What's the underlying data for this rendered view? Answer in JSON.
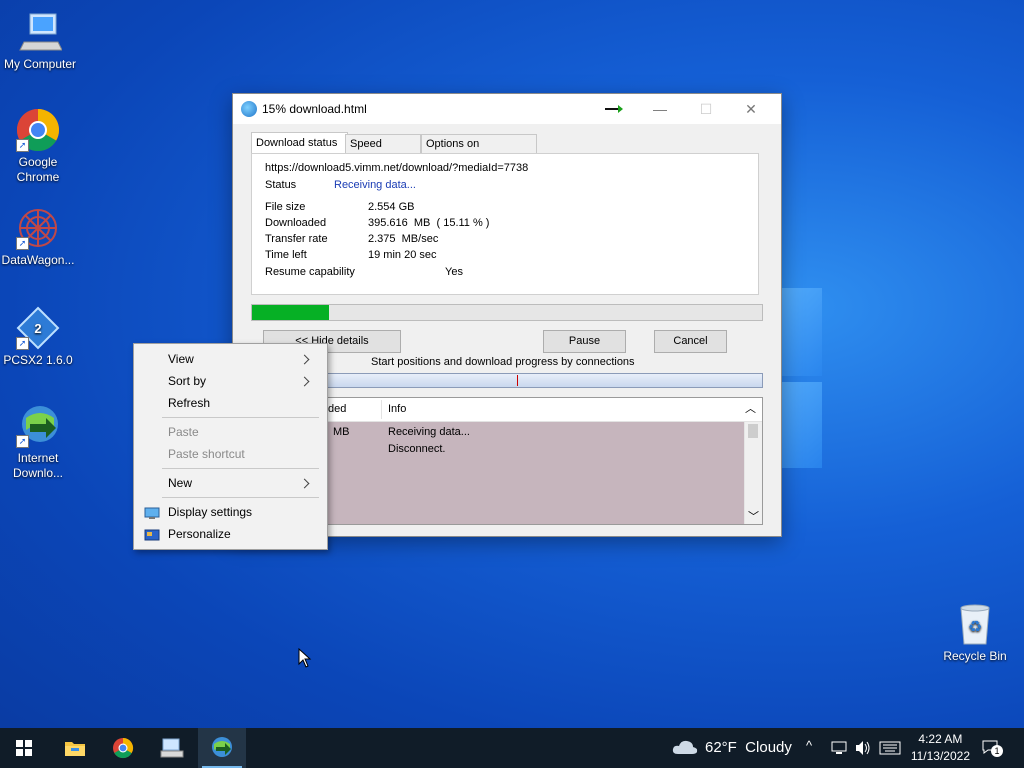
{
  "desktop": {
    "icons": [
      {
        "label": "My Computer"
      },
      {
        "label": "Google Chrome"
      },
      {
        "label": "DataWagon..."
      },
      {
        "label": "PCSX2 1.6.0"
      },
      {
        "label": "Internet Downlo..."
      },
      {
        "label": "Recycle Bin"
      }
    ]
  },
  "window": {
    "title": "15% download.html",
    "controls": {
      "minimize": "—",
      "maximize": "☐",
      "close": "✕"
    },
    "tabs": [
      {
        "label": "Download status"
      },
      {
        "label": "Speed Limiter"
      },
      {
        "label": "Options on completion"
      }
    ],
    "url": "https://download5.vimm.net/download/?mediaId=7738",
    "status_label": "Status",
    "status_value": "Receiving data...",
    "info": [
      {
        "label": "File size",
        "value": "2.554  GB"
      },
      {
        "label": "Downloaded",
        "value": "395.616  MB  ( 15.11 % )"
      },
      {
        "label": "Transfer rate",
        "value": "2.375  MB/sec"
      },
      {
        "label": "Time left",
        "value": "19 min 20 sec"
      },
      {
        "label": "Resume capability",
        "value": "Yes"
      }
    ],
    "progress_fraction": 0.1511,
    "buttons": {
      "hide_details": "<< Hide details",
      "pause": "Pause",
      "cancel": "Cancel"
    },
    "connections_caption": "Start positions and download progress by connections",
    "table": {
      "columns": [
        "ded",
        "Info"
      ],
      "rows": [
        {
          "downloaded": "MB",
          "info": "Receiving data..."
        },
        {
          "downloaded": "",
          "info": "Disconnect."
        }
      ]
    }
  },
  "context_menu": {
    "items": [
      {
        "label": "View",
        "submenu": true
      },
      {
        "label": "Sort by",
        "submenu": true
      },
      {
        "label": "Refresh"
      },
      {
        "label": "Paste",
        "disabled": true
      },
      {
        "label": "Paste shortcut",
        "disabled": true
      },
      {
        "label": "New",
        "submenu": true
      },
      {
        "label": "Display settings",
        "icon": "display-icon"
      },
      {
        "label": "Personalize",
        "icon": "personalize-icon"
      }
    ]
  },
  "taskbar": {
    "weather": "62°F  Cloudy",
    "time": "4:22 AM",
    "date": "11/13/2022",
    "notification_count": "1",
    "apps": [
      "start-icon",
      "file-explorer-icon",
      "chrome-icon",
      "keyboard-app-icon",
      "internet-download-manager-icon"
    ]
  },
  "colors": {
    "progress": "#06b025",
    "status_value": "#1a3cb4",
    "desktop": "#0b46b8",
    "taskbar": "#101c28"
  }
}
